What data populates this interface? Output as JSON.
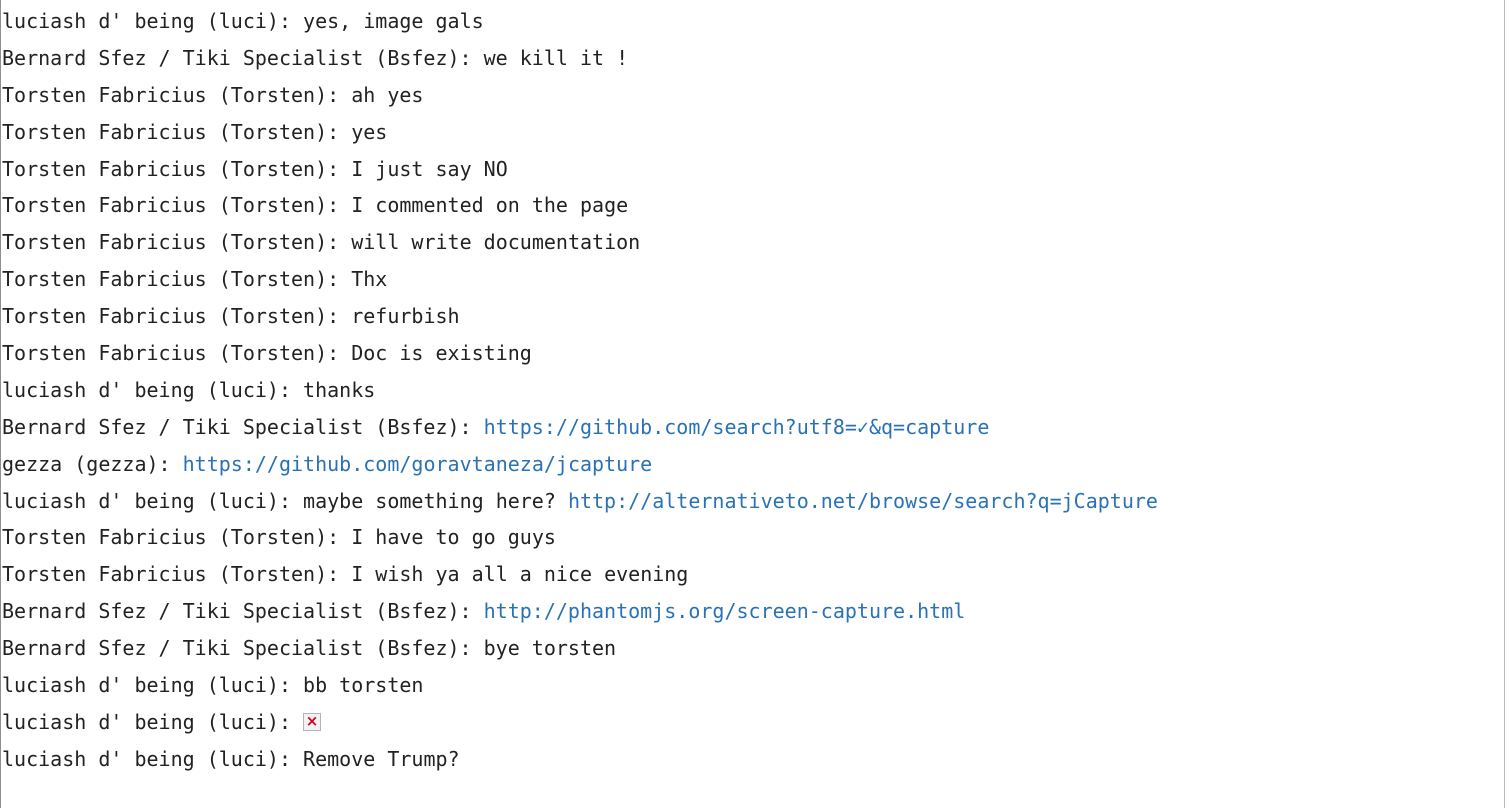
{
  "chat": {
    "messages": [
      {
        "author": "luciash d' being (luci): ",
        "text": "yes, image gals"
      },
      {
        "author": "Bernard Sfez / Tiki Specialist (Bsfez): ",
        "text": "we kill it !"
      },
      {
        "author": "Torsten Fabricius (Torsten): ",
        "text": "ah yes"
      },
      {
        "author": "Torsten Fabricius (Torsten): ",
        "text": "yes"
      },
      {
        "author": "Torsten Fabricius (Torsten): ",
        "text": "I just say NO"
      },
      {
        "author": "Torsten Fabricius (Torsten): ",
        "text": "I commented on the page"
      },
      {
        "author": "Torsten Fabricius (Torsten): ",
        "text": "will write documentation"
      },
      {
        "author": "Torsten Fabricius (Torsten): ",
        "text": "Thx"
      },
      {
        "author": "Torsten Fabricius (Torsten): ",
        "text": "refurbish"
      },
      {
        "author": "Torsten Fabricius (Torsten): ",
        "text": "Doc is existing"
      },
      {
        "author": "luciash d' being (luci): ",
        "text": "thanks"
      },
      {
        "author": "Bernard Sfez / Tiki Specialist (Bsfez): ",
        "link": "https://github.com/search?utf8=✓&q=capture"
      },
      {
        "author": "gezza (gezza): ",
        "link": "https://github.com/goravtaneza/jcapture"
      },
      {
        "author": "luciash d' being (luci): ",
        "text": "maybe something here? ",
        "link": "http://alternativeto.net/browse/search?q=jCapture"
      },
      {
        "author": "Torsten Fabricius (Torsten): ",
        "text": "I have to go guys"
      },
      {
        "author": "Torsten Fabricius (Torsten): ",
        "text": "I wish ya all a nice evening"
      },
      {
        "author": "Bernard Sfez / Tiki Specialist (Bsfez): ",
        "link": "http://phantomjs.org/screen-capture.html"
      },
      {
        "author": "Bernard Sfez / Tiki Specialist (Bsfez): ",
        "text": "bye torsten"
      },
      {
        "author": "luciash d' being (luci): ",
        "text": "bb torsten"
      },
      {
        "author": "luciash d' being (luci): ",
        "image": "broken-image-icon"
      },
      {
        "author": "luciash d' being (luci): ",
        "text": "Remove Trump?"
      }
    ]
  },
  "colors": {
    "text": "#222222",
    "link": "#2a72b5",
    "broken_image_x": "#d0021b"
  }
}
